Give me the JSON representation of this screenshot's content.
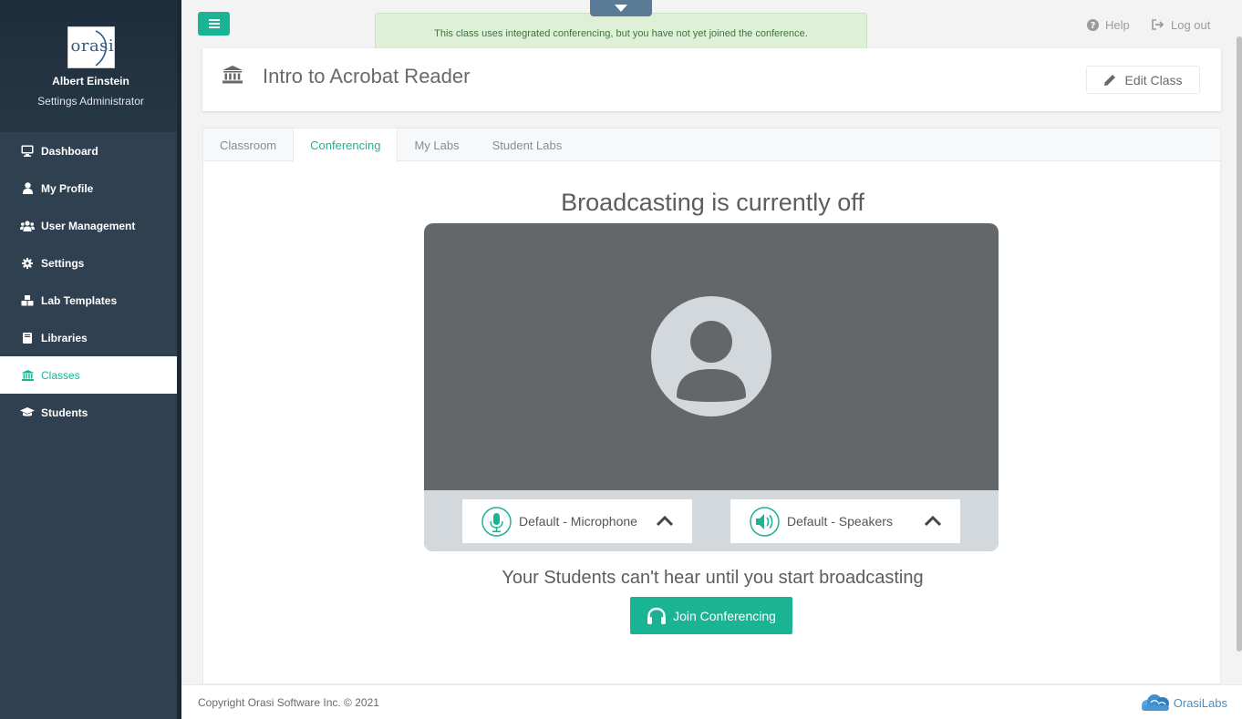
{
  "sidebar": {
    "logo_text": "orasi",
    "user_name": "Albert Einstein",
    "user_role": "Settings Administrator",
    "items": [
      {
        "label": "Dashboard",
        "icon": "monitor-icon"
      },
      {
        "label": "My Profile",
        "icon": "user-icon"
      },
      {
        "label": "User Management",
        "icon": "users-icon"
      },
      {
        "label": "Settings",
        "icon": "gear-icon"
      },
      {
        "label": "Lab Templates",
        "icon": "cubes-icon"
      },
      {
        "label": "Libraries",
        "icon": "book-icon"
      },
      {
        "label": "Classes",
        "icon": "bank-icon",
        "active": true
      },
      {
        "label": "Students",
        "icon": "graduation-cap-icon"
      }
    ]
  },
  "alert": {
    "text": "This class uses integrated conferencing, but you have not yet joined the conference."
  },
  "topbar": {
    "help_label": "Help",
    "logout_label": "Log out"
  },
  "class": {
    "title": "Intro to Acrobat Reader",
    "edit_label": "Edit Class"
  },
  "tabs": [
    {
      "label": "Classroom"
    },
    {
      "label": "Conferencing",
      "active": true
    },
    {
      "label": "My Labs"
    },
    {
      "label": "Student Labs"
    }
  ],
  "conference": {
    "status_title": "Broadcasting is currently off",
    "microphone_label": "Default - Microphone",
    "speakers_label": "Default - Speakers",
    "info_text": "Your Students can't hear until you start broadcasting",
    "join_label": "Join Conferencing"
  },
  "footer": {
    "copyright": "Copyright Orasi Software Inc. © 2021",
    "brand": "OrasiLabs"
  },
  "colors": {
    "accent": "#1ab394",
    "sidebar": "#2f4050",
    "alert_bg": "#dff0d8"
  }
}
